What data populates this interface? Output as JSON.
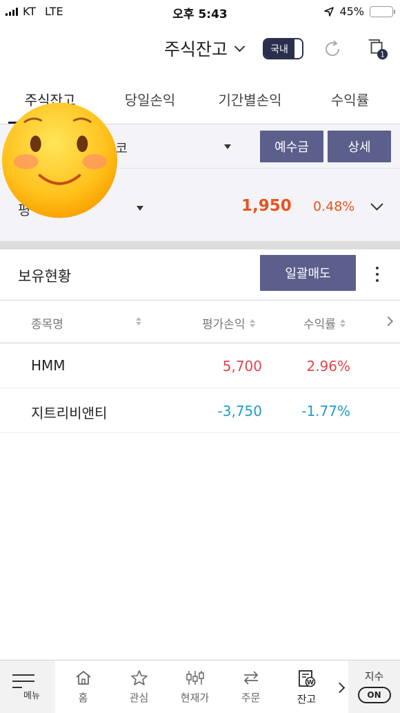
{
  "status_bar": {
    "carrier": "KT",
    "network": "LTE",
    "time": "오후 5:43",
    "battery": "45%",
    "battery_level": 0.45
  },
  "header": {
    "title": "주식잔고",
    "market_toggle": "국내"
  },
  "tabs": [
    {
      "label": "주식잔고",
      "active": true
    },
    {
      "label": "당일손익",
      "active": false
    },
    {
      "label": "기간별손익",
      "active": false
    },
    {
      "label": "수익률",
      "active": false
    }
  ],
  "account": {
    "name_fragment": "투코",
    "deposit_button": "예수금",
    "detail_button": "상세",
    "summary_label_fragment": "평",
    "amount": "1,950",
    "percent": "0.48%"
  },
  "holdings": {
    "title": "보유현황",
    "sell_all_button": "일괄매도",
    "columns": [
      "종목명",
      "평가손익",
      "수익률"
    ],
    "rows": [
      {
        "name": "HMM",
        "profit_loss": "5,700",
        "return_rate": "2.96%",
        "direction": "up"
      },
      {
        "name": "지트리비앤티",
        "profit_loss": "-3,750",
        "return_rate": "-1.77%",
        "direction": "down"
      }
    ]
  },
  "bottom_nav": {
    "menu": "메뉴",
    "items": [
      {
        "label": "홈",
        "icon": "home-icon"
      },
      {
        "label": "관심",
        "icon": "star-icon"
      },
      {
        "label": "현재가",
        "icon": "candlestick-icon"
      },
      {
        "label": "주문",
        "icon": "swap-arrows-icon"
      },
      {
        "label": "잔고",
        "icon": "balance-doc-icon"
      }
    ],
    "index_label": "지수",
    "index_toggle": "ON"
  },
  "colors": {
    "up": "#e8541d",
    "row_up": "#e0454d",
    "down": "#1f9cc9",
    "accent": "#5c5f8b",
    "toggle": "#2b2f4d"
  }
}
